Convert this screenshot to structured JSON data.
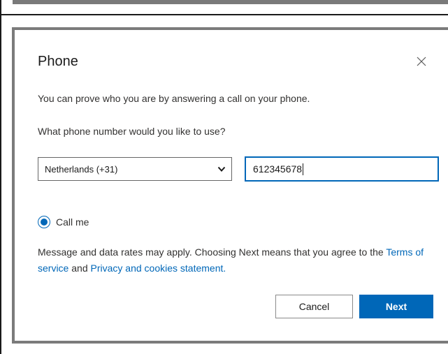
{
  "dialog": {
    "title": "Phone",
    "intro_text": "You can prove who you are by answering a call on your phone.",
    "question_text": "What phone number would you like to use?",
    "country_select": {
      "selected": "Netherlands (+31)"
    },
    "phone_input": {
      "value": "612345678"
    },
    "method_option": {
      "label": "Call me",
      "checked": true
    },
    "disclaimer": {
      "line_prefix": "Message and data rates may apply. Choosing Next means that you agree to the ",
      "terms_link": "Terms of service",
      "conjunction": " and ",
      "privacy_link": "Privacy and cookies statement."
    },
    "buttons": {
      "cancel_label": "Cancel",
      "next_label": "Next"
    }
  },
  "icons": {
    "close": "close-icon",
    "dropdown": "chevron-down-icon"
  },
  "colors": {
    "accent": "#0067b8",
    "text": "#323130",
    "dialog_border": "#7b7b7b"
  }
}
